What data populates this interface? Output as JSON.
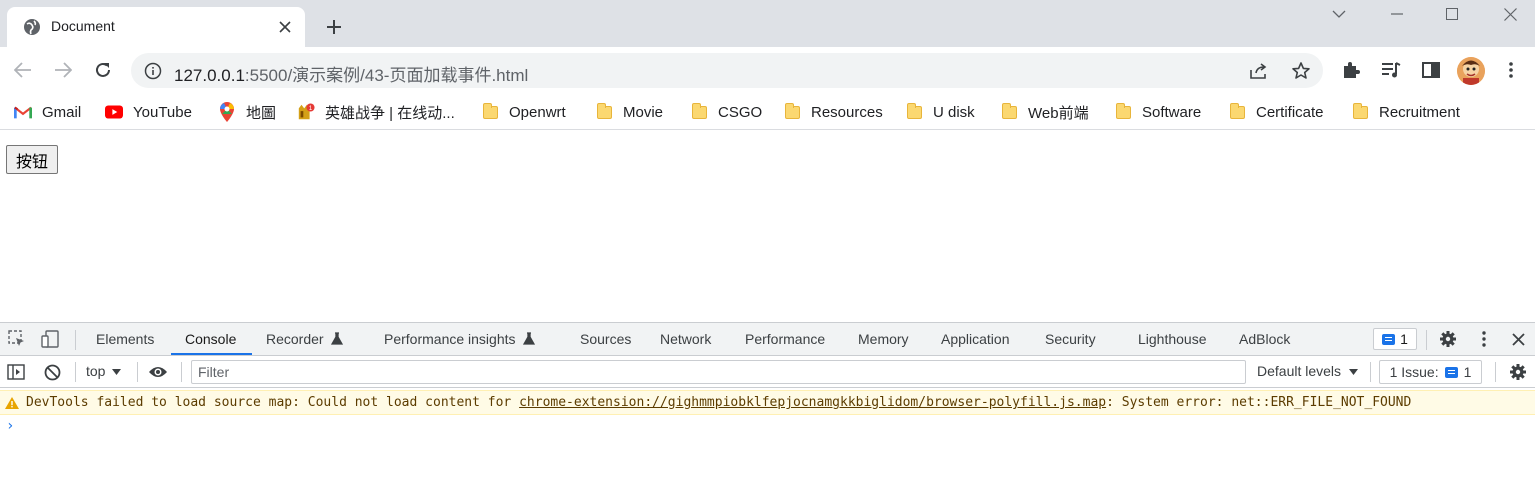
{
  "tab": {
    "title": "Document"
  },
  "toolbar": {
    "url_host": "127.0.0.1",
    "url_rest": ":5500/演示案例/43-页面加载事件.html"
  },
  "bookmarks": [
    {
      "label": "Gmail",
      "icon": "gmail-icon"
    },
    {
      "label": "YouTube",
      "icon": "youtube-icon"
    },
    {
      "label": "地圖",
      "icon": "maps-icon"
    },
    {
      "label": "英雄战争 | 在线动...",
      "icon": "game-icon"
    },
    {
      "label": "Openwrt",
      "icon": "folder-icon"
    },
    {
      "label": "Movie",
      "icon": "folder-icon"
    },
    {
      "label": "CSGO",
      "icon": "folder-icon"
    },
    {
      "label": "Resources",
      "icon": "folder-icon"
    },
    {
      "label": "U disk",
      "icon": "folder-icon"
    },
    {
      "label": "Web前端",
      "icon": "folder-icon"
    },
    {
      "label": "Software",
      "icon": "folder-icon"
    },
    {
      "label": "Certificate",
      "icon": "folder-icon"
    },
    {
      "label": "Recruitment",
      "icon": "folder-icon"
    }
  ],
  "page": {
    "button_label": "按钮"
  },
  "devtools": {
    "tabs": [
      {
        "label": "Elements"
      },
      {
        "label": "Console",
        "active": true
      },
      {
        "label": "Recorder"
      },
      {
        "label": "Performance insights"
      },
      {
        "label": "Sources"
      },
      {
        "label": "Network"
      },
      {
        "label": "Performance"
      },
      {
        "label": "Memory"
      },
      {
        "label": "Application"
      },
      {
        "label": "Security"
      },
      {
        "label": "Lighthouse"
      },
      {
        "label": "AdBlock"
      }
    ],
    "issue_count": "1",
    "context": "top",
    "filter_placeholder": "Filter",
    "levels": "Default levels",
    "issues_label": "1 Issue:",
    "issues_count": "1",
    "warning": {
      "prefix": "DevTools failed to load source map: Could not load content for ",
      "link": "chrome-extension://gighmmpiobklfepjocnamgkkbiglidom/browser-polyfill.js.map",
      "suffix": ": System error: net::ERR_FILE_NOT_FOUND"
    },
    "prompt": "›"
  },
  "colors": {
    "tabstrip_bg": "#dee1e6",
    "accent": "#1a73e8",
    "warning_bg": "#fffbe6",
    "warning_text": "#5c3c00"
  }
}
